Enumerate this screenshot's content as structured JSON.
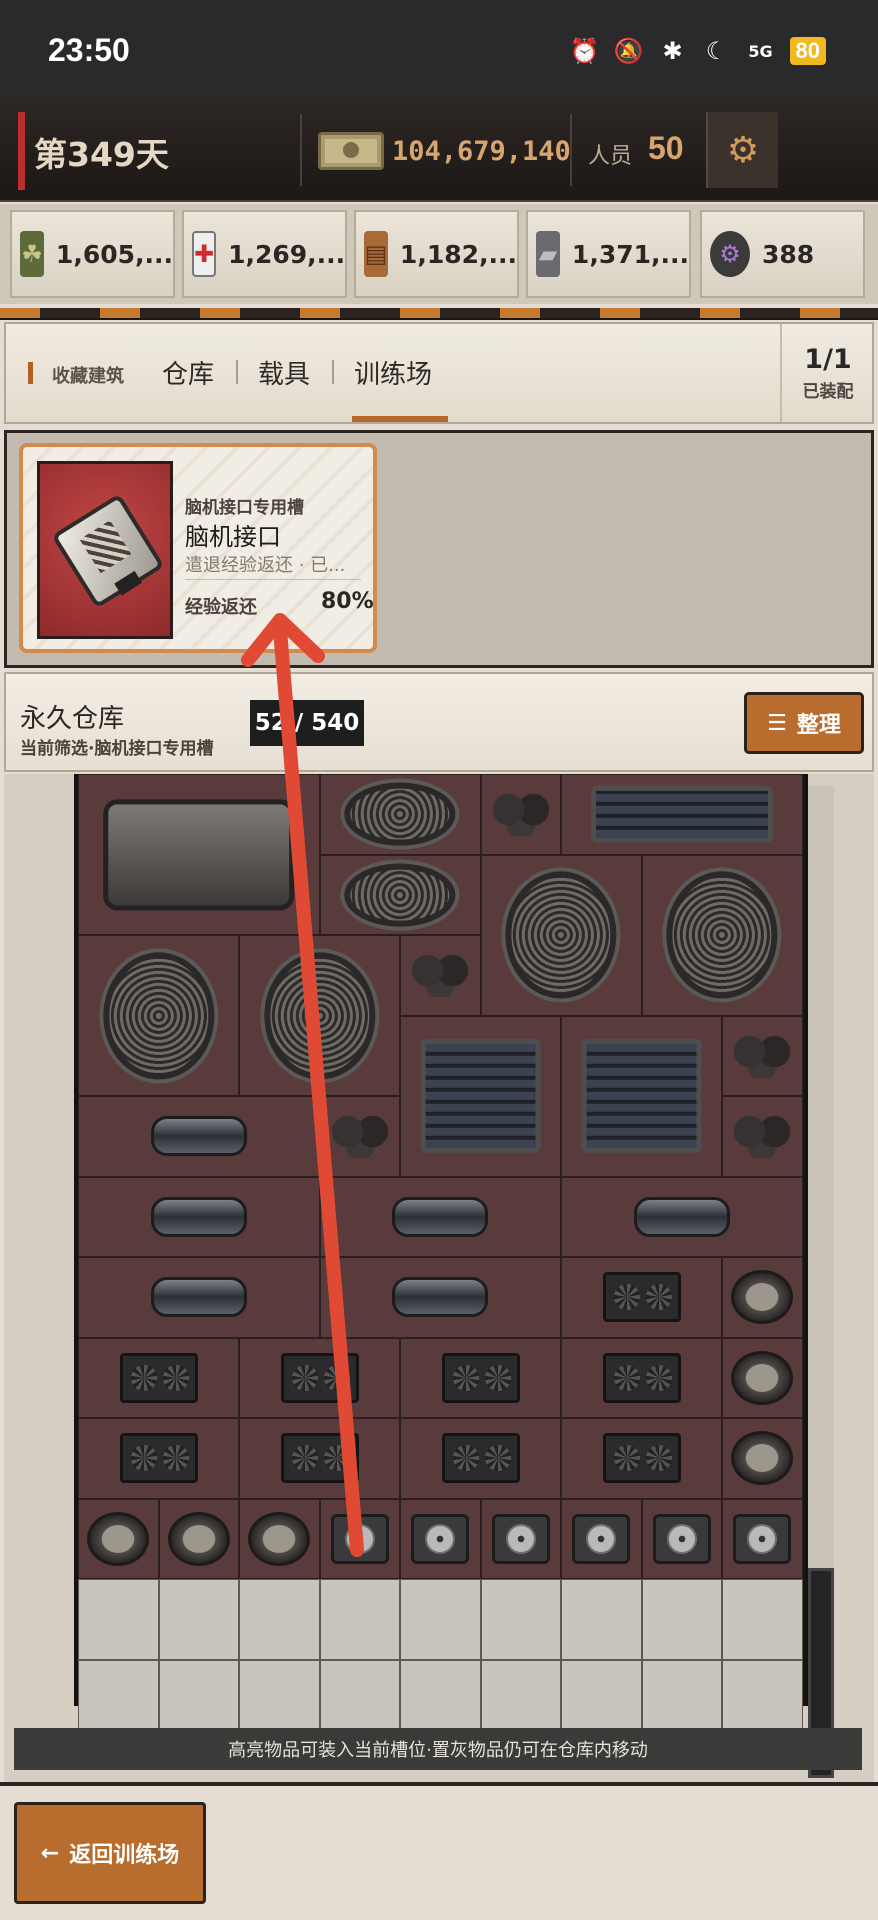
{
  "status_bar": {
    "time": "23:50",
    "network": "5G",
    "battery": "80"
  },
  "top_bar": {
    "day": "第349天",
    "money": "104,679,140",
    "staff_label": "人员",
    "staff_count": "50"
  },
  "resources": [
    {
      "icon": "wheat-can-icon",
      "value": "1,605,..."
    },
    {
      "icon": "medkit-icon",
      "value": "1,269,..."
    },
    {
      "icon": "lumber-icon",
      "value": "1,182,..."
    },
    {
      "icon": "steel-ingot-icon",
      "value": "1,371,..."
    },
    {
      "icon": "gear-chip-icon",
      "value": "388"
    }
  ],
  "tabs": {
    "favorites": "收藏建筑",
    "items": [
      "仓库",
      "载具",
      "训练场"
    ],
    "active_tab": "训练场",
    "equipped_count": "1/1",
    "equipped_label": "已装配"
  },
  "slot": {
    "type": "脑机接口专用槽",
    "name": "脑机接口",
    "description": "遣退经验返还 · 已...",
    "exp_label": "经验返还",
    "exp_value": "80%"
  },
  "storage": {
    "title": "永久仓库",
    "filter": "当前筛选·脑机接口专用槽",
    "capacity": "52 / 540",
    "sort_label": "整理"
  },
  "hint": "高亮物品可装入当前槽位·置灰物品仍可在仓库内移动",
  "back_button": "返回训练场",
  "colors": {
    "accent": "#b86d2e",
    "money": "#d7a56e",
    "day_accent": "#b8302b",
    "annotation_arrow": "#e04a35"
  }
}
